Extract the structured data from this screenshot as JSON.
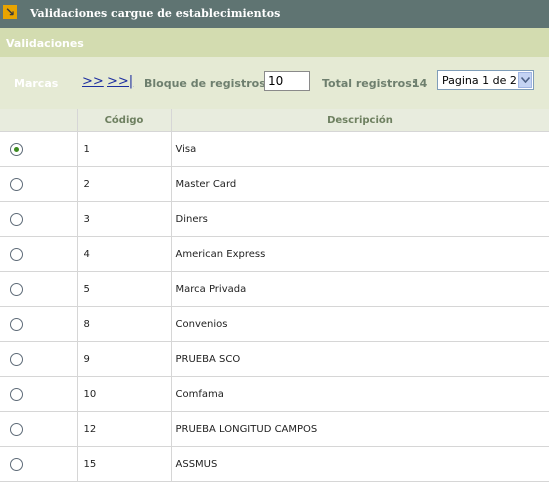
{
  "window": {
    "title": "Validaciones cargue de establecimientos",
    "icon": "arrow-down-right-icon"
  },
  "section": {
    "title": "Validaciones"
  },
  "toolbar": {
    "marcas_label": "Marcas",
    "next_link": ">>",
    "last_link": ">>|",
    "bloque_label": "Bloque de registros:",
    "bloque_value": "10",
    "total_label": "Total registros:",
    "total_value": "14",
    "page_select": "Pagina 1 de 2"
  },
  "table": {
    "columns": [
      "",
      "Código",
      "Descripción"
    ],
    "rows": [
      {
        "code": "1",
        "desc": "Visa",
        "selected": true
      },
      {
        "code": "2",
        "desc": "Master Card",
        "selected": false
      },
      {
        "code": "3",
        "desc": "Diners",
        "selected": false
      },
      {
        "code": "4",
        "desc": "American Express",
        "selected": false
      },
      {
        "code": "5",
        "desc": "Marca Privada",
        "selected": false
      },
      {
        "code": "8",
        "desc": "Convenios",
        "selected": false
      },
      {
        "code": "9",
        "desc": "PRUEBA SCO",
        "selected": false
      },
      {
        "code": "10",
        "desc": "Comfama",
        "selected": false
      },
      {
        "code": "12",
        "desc": "PRUEBA LONGITUD CAMPOS",
        "selected": false
      },
      {
        "code": "15",
        "desc": "ASSMUS",
        "selected": false
      }
    ]
  },
  "colors": {
    "titlebar": "#5f7472",
    "subheader": "#d3dcb0",
    "toolbar": "#e5ead4",
    "link": "#1d2fa0",
    "radio_selected": "#3c8a1f"
  }
}
